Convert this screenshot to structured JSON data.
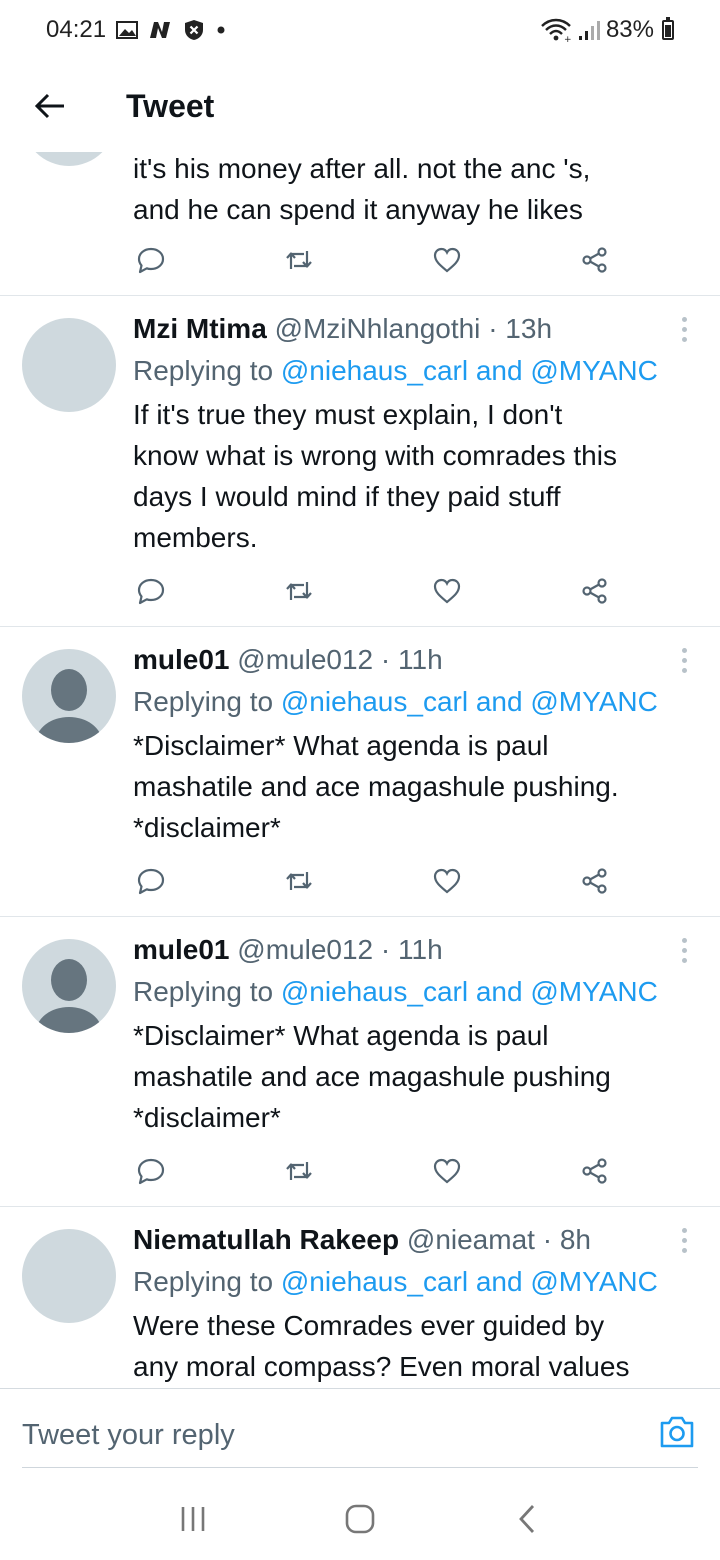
{
  "status_bar": {
    "time": "04:21",
    "battery": "83%",
    "icons": [
      "gallery-icon",
      "n-app-icon",
      "shield-icon",
      "dot-icon",
      "wifi-icon",
      "signal-icon",
      "battery-icon"
    ]
  },
  "header": {
    "title": "Tweet",
    "back_icon": "arrow-left-icon"
  },
  "colors": {
    "link": "#1d9bf0",
    "secondary_text": "#536471",
    "avatar_bg": "#cfd9de"
  },
  "partial_tweet": {
    "text": "it's his money after all. not the anc 's,\nand he can spend it anyway he likes"
  },
  "tweets": [
    {
      "name": "Mzi Mtima",
      "handle": "@MziNhlangothi",
      "time": "13h",
      "replying_label": "Replying to",
      "mention1": "@niehaus_carl",
      "and": "and",
      "mention2": "@MYANC",
      "text": "If it's true they must explain, I don't\nknow what is wrong with comrades this\ndays I would mind if they paid stuff\nmembers.",
      "avatar": "blank"
    },
    {
      "name": "mule01",
      "handle": "@mule012",
      "time": "11h",
      "replying_label": "Replying to",
      "mention1": "@niehaus_carl",
      "and": "and",
      "mention2": "@MYANC",
      "text": "*Disclaimer* What agenda is paul\nmashatile and ace magashule pushing.\n*disclaimer*",
      "avatar": "default-person"
    },
    {
      "name": "mule01",
      "handle": "@mule012",
      "time": "11h",
      "replying_label": "Replying to",
      "mention1": "@niehaus_carl",
      "and": "and",
      "mention2": "@MYANC",
      "text": "*Disclaimer* What agenda is paul\nmashatile and ace magashule pushing\n*disclaimer*",
      "avatar": "default-person"
    },
    {
      "name": "Niematullah Rakeep",
      "handle": "@nieamat",
      "time": "8h",
      "replying_label": "Replying to",
      "mention1": "@niehaus_carl",
      "and": "and",
      "mention2": "@MYANC",
      "text": "Were these Comrades ever guided by\nany moral compass? Even moral values",
      "avatar": "blank"
    }
  ],
  "reply_bar": {
    "placeholder": "Tweet your reply",
    "camera_icon": "camera-icon"
  },
  "nav_bar": {
    "icons": [
      "recent-apps-icon",
      "home-icon",
      "back-icon"
    ]
  }
}
